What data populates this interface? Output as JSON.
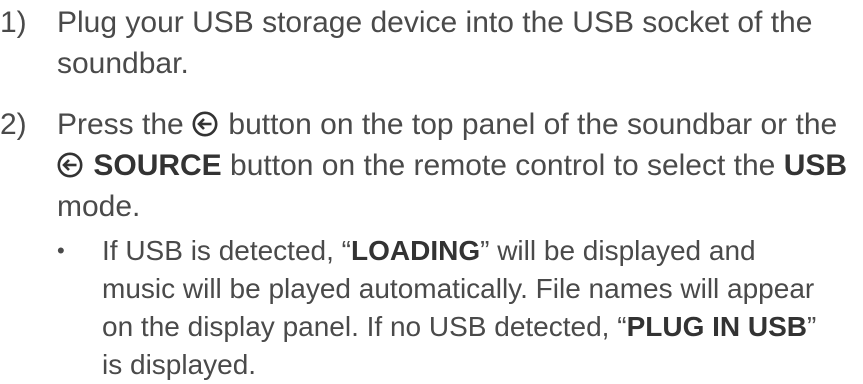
{
  "colors": {
    "text": "#4a4a4a",
    "emphasis": "#333333"
  },
  "steps": [
    {
      "number": "1)",
      "text": "Plug your USB storage device into the USB socket of the soundbar."
    },
    {
      "number": "2)",
      "text_before_icon": "Press the ",
      "icon": "source-icon",
      "text_after_icon": " button on the top panel of the soundbar or the ",
      "source_label": "SOURCE",
      "text_after_source": " button on the remote control to select the ",
      "usb_label": "USB",
      "text_end": " mode."
    }
  ],
  "note": {
    "bullet": "•",
    "part1": "If USB is detected, “",
    "loading": "LOADING",
    "part2": "” will be displayed and music will be played automatically. File names will appear on the display panel. If no USB detected, “",
    "plug_in_usb": "PLUG IN USB",
    "part3": "” is displayed."
  }
}
